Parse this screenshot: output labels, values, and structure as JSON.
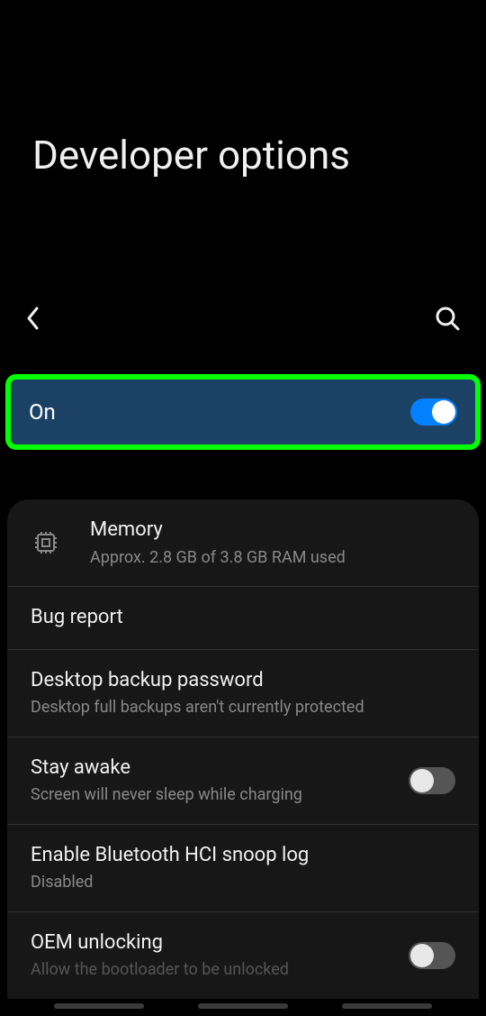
{
  "header": {
    "title": "Developer options"
  },
  "mainToggle": {
    "label": "On",
    "state": true
  },
  "settings": [
    {
      "title": "Memory",
      "subtitle": "Approx. 2.8 GB of 3.8 GB RAM used",
      "hasIcon": true
    },
    {
      "title": "Bug report"
    },
    {
      "title": "Desktop backup password",
      "subtitle": "Desktop full backups aren't currently protected"
    },
    {
      "title": "Stay awake",
      "subtitle": "Screen will never sleep while charging",
      "toggle": false
    },
    {
      "title": "Enable Bluetooth HCI snoop log",
      "subtitle": "Disabled"
    },
    {
      "title": "OEM unlocking",
      "subtitle": "Allow the bootloader to be unlocked",
      "toggle": false
    }
  ]
}
